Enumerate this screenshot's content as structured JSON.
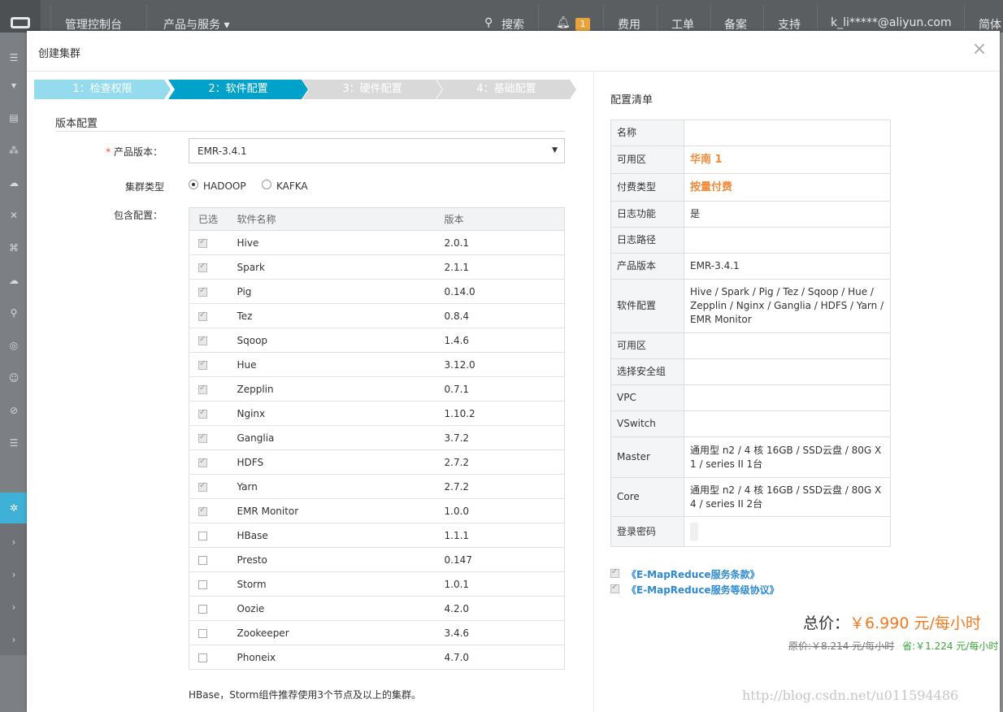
{
  "topbar": {
    "console": "管理控制台",
    "products": "产品与服务 ▾",
    "search": "搜索",
    "notification_count": "1",
    "billing": "费用",
    "tickets": "工单",
    "icp": "备案",
    "support": "支持",
    "account": "k_li*****@aliyun.com",
    "language": "简体"
  },
  "modal": {
    "title": "创建集群",
    "close": "×"
  },
  "steps": [
    {
      "label": "1：检查权限"
    },
    {
      "label": "2：软件配置"
    },
    {
      "label": "3：硬件配置"
    },
    {
      "label": "4：基础配置"
    }
  ],
  "form": {
    "section_title": "版本配置",
    "required_mark": "*",
    "version_label": "产品版本：",
    "version_value": "EMR-3.4.1",
    "cluster_type_label": "集群类型",
    "cluster_types": [
      "HADOOP",
      "KAFKA"
    ],
    "selected_cluster_type": "HADOOP",
    "included_label": "包含配置：",
    "table_headers": [
      "已选",
      "软件名称",
      "版本"
    ],
    "software": [
      {
        "name": "Hive",
        "version": "2.0.1",
        "checked": true
      },
      {
        "name": "Spark",
        "version": "2.1.1",
        "checked": true
      },
      {
        "name": "Pig",
        "version": "0.14.0",
        "checked": true
      },
      {
        "name": "Tez",
        "version": "0.8.4",
        "checked": true
      },
      {
        "name": "Sqoop",
        "version": "1.4.6",
        "checked": true
      },
      {
        "name": "Hue",
        "version": "3.12.0",
        "checked": true
      },
      {
        "name": "Zepplin",
        "version": "0.7.1",
        "checked": true
      },
      {
        "name": "Nginx",
        "version": "1.10.2",
        "checked": true
      },
      {
        "name": "Ganglia",
        "version": "3.7.2",
        "checked": true
      },
      {
        "name": "HDFS",
        "version": "2.7.2",
        "checked": true
      },
      {
        "name": "Yarn",
        "version": "2.7.2",
        "checked": true
      },
      {
        "name": "EMR Monitor",
        "version": "1.0.0",
        "checked": true
      },
      {
        "name": "HBase",
        "version": "1.1.1",
        "checked": false
      },
      {
        "name": "Presto",
        "version": "0.147",
        "checked": false
      },
      {
        "name": "Storm",
        "version": "1.0.1",
        "checked": false
      },
      {
        "name": "Oozie",
        "version": "4.2.0",
        "checked": false
      },
      {
        "name": "Zookeeper",
        "version": "3.4.6",
        "checked": false
      },
      {
        "name": "Phoneix",
        "version": "4.7.0",
        "checked": false
      }
    ],
    "note": "HBase，Storm组件推荐使用3个节点及以上的集群。"
  },
  "config_list": {
    "title": "配置清单",
    "rows": [
      {
        "key": "名称",
        "value": "",
        "highlight": false
      },
      {
        "key": "可用区",
        "value": "华南 1",
        "highlight": true
      },
      {
        "key": "付费类型",
        "value": "按量付费",
        "highlight": true
      },
      {
        "key": "日志功能",
        "value": "是",
        "highlight": false
      },
      {
        "key": "日志路径",
        "value": "",
        "highlight": false
      },
      {
        "key": "产品版本",
        "value": "EMR-3.4.1",
        "highlight": false
      },
      {
        "key": "软件配置",
        "value": "Hive / Spark / Pig / Tez / Sqoop / Hue / Zepplin / Nginx / Ganglia / HDFS / Yarn / EMR Monitor",
        "highlight": false
      },
      {
        "key": "可用区",
        "value": "",
        "highlight": false
      },
      {
        "key": "选择安全组",
        "value": "",
        "highlight": false
      },
      {
        "key": "VPC",
        "value": "",
        "highlight": false
      },
      {
        "key": "VSwitch",
        "value": "",
        "highlight": false
      },
      {
        "key": "Master",
        "value": "通用型 n2 / 4 核 16GB / SSD云盘 / 80G X 1 / series II 1台",
        "highlight": false
      },
      {
        "key": "Core",
        "value": "通用型 n2 / 4 核 16GB / SSD云盘 / 80G X 4 / series II 2台",
        "highlight": false
      },
      {
        "key": "登录密码",
        "value": "",
        "highlight": false
      }
    ]
  },
  "agreements": [
    {
      "label": "《E-MapReduce服务条款》",
      "checked": true
    },
    {
      "label": "《E-MapReduce服务等级协议》",
      "checked": true
    }
  ],
  "pricing": {
    "total_label": "总价：",
    "total_value": "￥6.990 元/每小时",
    "original": "原价:￥8.214 元/每小时",
    "savings": "省:￥1.224 元/每小时"
  },
  "watermark": "http://blog.csdn.net/u011594486"
}
